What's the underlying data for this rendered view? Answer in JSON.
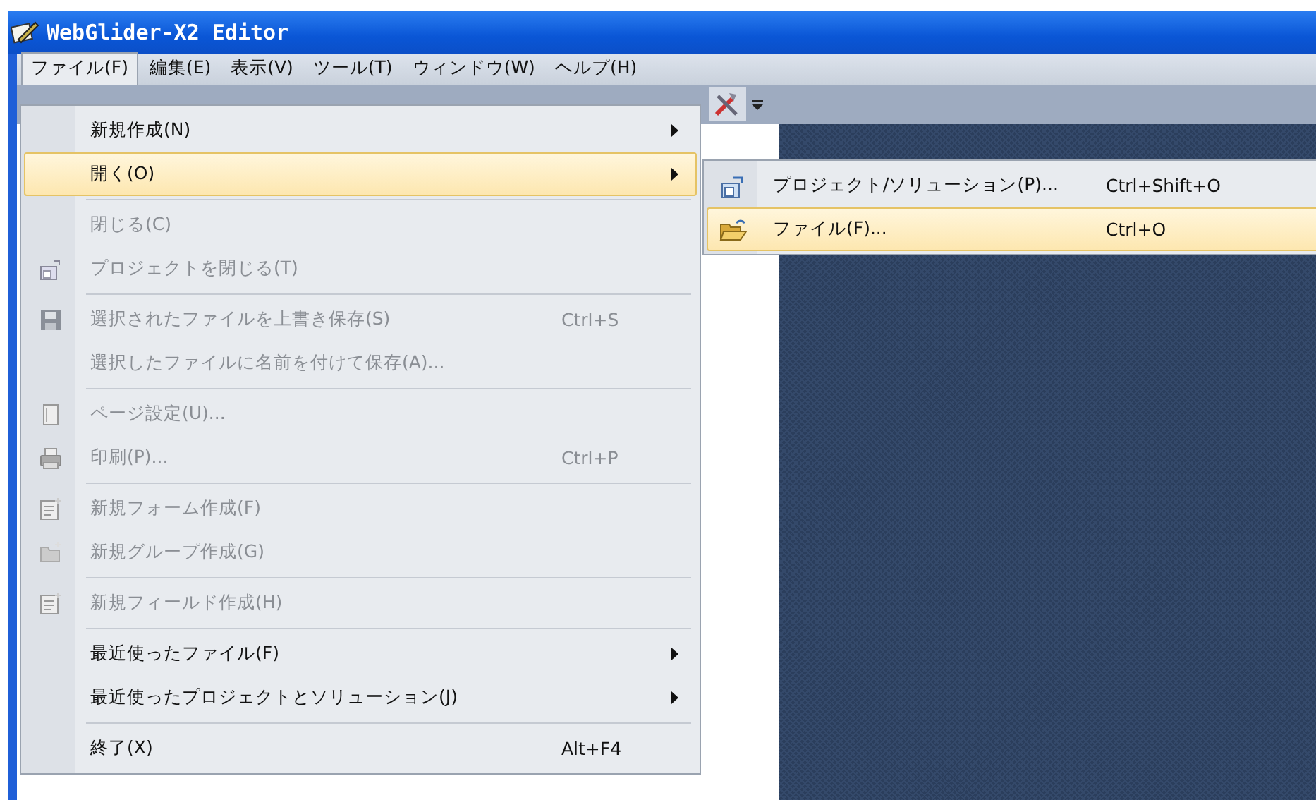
{
  "window": {
    "title": "WebGlider-X2 Editor"
  },
  "menu_bar": [
    {
      "label": "ファイル(F)",
      "selected": true
    },
    {
      "label": "編集(E)",
      "selected": false
    },
    {
      "label": "表示(V)",
      "selected": false
    },
    {
      "label": "ツール(T)",
      "selected": false
    },
    {
      "label": "ウィンドウ(W)",
      "selected": false
    },
    {
      "label": "ヘルプ(H)",
      "selected": false
    }
  ],
  "file_menu": [
    {
      "kind": "item",
      "label": "新規作成(N)",
      "submenu": true,
      "disabled": false,
      "selected": false
    },
    {
      "kind": "item",
      "label": "開く(O)",
      "submenu": true,
      "disabled": false,
      "selected": true
    },
    {
      "kind": "separator"
    },
    {
      "kind": "item",
      "label": "閉じる(C)",
      "submenu": false,
      "disabled": true,
      "selected": false
    },
    {
      "kind": "item",
      "label": "プロジェクトを閉じる(T)",
      "submenu": false,
      "disabled": true,
      "selected": false
    },
    {
      "kind": "separator"
    },
    {
      "kind": "item",
      "label": "選択されたファイルを上書き保存(S)",
      "shortcut": "Ctrl+S",
      "submenu": false,
      "disabled": true,
      "selected": false
    },
    {
      "kind": "item",
      "label": "選択したファイルに名前を付けて保存(A)...",
      "submenu": false,
      "disabled": true,
      "selected": false
    },
    {
      "kind": "separator"
    },
    {
      "kind": "item",
      "label": "ページ設定(U)...",
      "submenu": false,
      "disabled": true,
      "selected": false
    },
    {
      "kind": "item",
      "label": "印刷(P)...",
      "shortcut": "Ctrl+P",
      "submenu": false,
      "disabled": true,
      "selected": false
    },
    {
      "kind": "separator"
    },
    {
      "kind": "item",
      "label": "新規フォーム作成(F)",
      "submenu": false,
      "disabled": true,
      "selected": false
    },
    {
      "kind": "item",
      "label": "新規グループ作成(G)",
      "submenu": false,
      "disabled": true,
      "selected": false
    },
    {
      "kind": "separator"
    },
    {
      "kind": "item",
      "label": "新規フィールド作成(H)",
      "submenu": false,
      "disabled": true,
      "selected": false
    },
    {
      "kind": "separator"
    },
    {
      "kind": "item",
      "label": "最近使ったファイル(F)",
      "submenu": true,
      "disabled": false,
      "selected": false
    },
    {
      "kind": "item",
      "label": "最近使ったプロジェクトとソリューション(J)",
      "submenu": true,
      "disabled": false,
      "selected": false
    },
    {
      "kind": "separator"
    },
    {
      "kind": "item",
      "label": "終了(X)",
      "shortcut": "Alt+F4",
      "submenu": false,
      "disabled": false,
      "selected": false
    }
  ],
  "open_submenu": [
    {
      "label": "プロジェクト/ソリューション(P)...",
      "shortcut": "Ctrl+Shift+O",
      "selected": false
    },
    {
      "label": "ファイル(F)...",
      "shortcut": "Ctrl+O",
      "selected": true
    }
  ]
}
